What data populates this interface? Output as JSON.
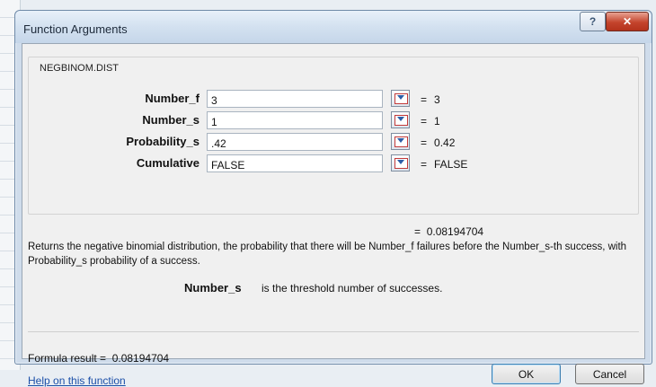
{
  "dialog": {
    "title": "Function Arguments",
    "help_glyph": "?",
    "close_glyph": "✕"
  },
  "function": {
    "name": "NEGBINOM.DIST",
    "args": [
      {
        "label": "Number_f",
        "value": "3",
        "evaluated": "3"
      },
      {
        "label": "Number_s",
        "value": "1",
        "evaluated": "1"
      },
      {
        "label": "Probability_s",
        "value": ".42",
        "evaluated": "0.42"
      },
      {
        "label": "Cumulative",
        "value": "FALSE",
        "evaluated": "FALSE"
      }
    ],
    "eq_sign": "=",
    "result": "0.08194704",
    "description": "Returns the negative binomial distribution, the probability that there will be Number_f failures before the Number_s-th success, with Probability_s probability of a success.",
    "arg_help_name": "Number_s",
    "arg_help_text": "is the threshold number of successes."
  },
  "footer": {
    "formula_result_label": "Formula result =",
    "formula_result_value": "0.08194704",
    "help_link": "Help on this function",
    "ok_label": "OK",
    "cancel_label": "Cancel"
  },
  "colors": {
    "title_bar": "#d3e1f0",
    "close_button": "#c4442c",
    "link": "#1b4fa8"
  },
  "icons": [
    "help-icon",
    "close-icon",
    "collapse-dialog-icon"
  ]
}
